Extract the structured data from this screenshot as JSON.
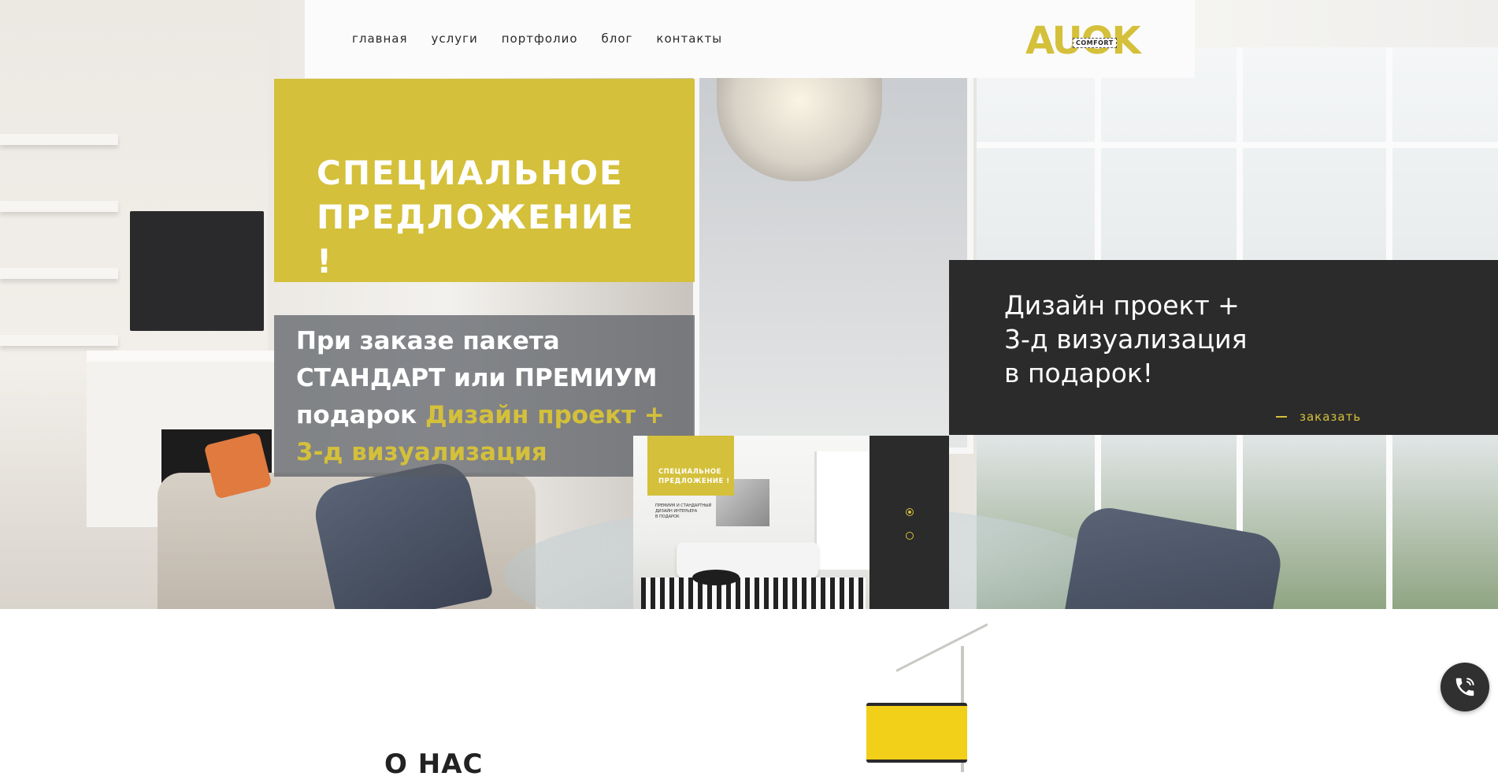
{
  "nav": {
    "items": [
      {
        "label": "главная"
      },
      {
        "label": "услуги"
      },
      {
        "label": "портфолио"
      },
      {
        "label": "блог"
      },
      {
        "label": "контакты"
      }
    ],
    "logo": {
      "text": "AUOK",
      "sub": "COMFORT"
    }
  },
  "promo": {
    "title": "СПЕЦИАЛЬНОЕ ПРЕДЛОЖЕНИЕ !",
    "body_prefix": "При заказе пакета СТАНДАРТ или ПРЕМИУМ подарок",
    "body_highlight": "Дизайн проект + 3-д визуализация"
  },
  "offer": {
    "lines": [
      "Дизайн проект +",
      "3-д визуализация",
      "в подарок!"
    ],
    "order_label": "заказать"
  },
  "thumb": {
    "tag_lines": [
      "СПЕЦИАЛЬНОЕ",
      "ПРЕДЛОЖЕНИЕ !"
    ],
    "small_lines": [
      "ПРЕМИУМ И СТАНДАРТНЫЙ",
      "ДИЗАЙН ИНТЕРЬЕРА",
      "В ПОДАРОК"
    ]
  },
  "slider": {
    "count": 2,
    "active_index": 0
  },
  "about": {
    "heading": "О НАС"
  },
  "colors": {
    "accent": "#d4c03a",
    "dark": "#2b2b2b",
    "nav_bg": "#fbfbfb"
  },
  "icons": {
    "call": "phone-icon",
    "dash": "dash-icon"
  }
}
